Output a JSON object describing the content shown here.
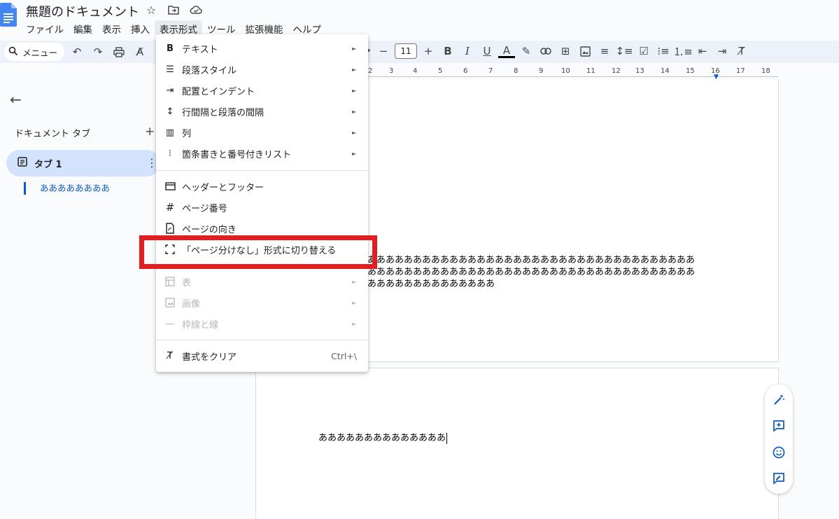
{
  "header": {
    "doc_title": "無題のドキュメント",
    "menu": [
      "ファイル",
      "編集",
      "表示",
      "挿入",
      "表示形式",
      "ツール",
      "拡張機能",
      "ヘルプ"
    ],
    "active_menu": "表示形式"
  },
  "toolbar": {
    "menu_search_label": "メニュー",
    "font_size": "11"
  },
  "sidebar": {
    "tabs_heading": "ドキュメント タブ",
    "tab_label": "タブ 1",
    "outline_item": "ああああああああ"
  },
  "ruler": {
    "ticks": [
      "2",
      "3",
      "4",
      "5",
      "6",
      "7",
      "8",
      "9",
      "10",
      "11",
      "12",
      "13",
      "14",
      "15",
      "16",
      "17",
      "18"
    ]
  },
  "document": {
    "page1_text": "ああああああああああああああああああああああああああああああああああああ\nああああああああああああああああああああああああああああああああああああ\nああああああああああああああ",
    "page2_text": "ああああああああああああああ"
  },
  "format_menu": {
    "items": [
      {
        "label": "テキスト",
        "icon": "bold-icon",
        "submenu": true
      },
      {
        "label": "段落スタイル",
        "icon": "paragraph-style-icon",
        "submenu": true
      },
      {
        "label": "配置とインデント",
        "icon": "indent-icon",
        "submenu": true
      },
      {
        "label": "行間隔と段落の間隔",
        "icon": "line-spacing-icon",
        "submenu": true
      },
      {
        "label": "列",
        "icon": "columns-icon",
        "submenu": true
      },
      {
        "label": "箇条書きと番号付きリスト",
        "icon": "list-icon",
        "submenu": true
      },
      {
        "label": "ヘッダーとフッター",
        "icon": "header-footer-icon",
        "submenu": false
      },
      {
        "label": "ページ番号",
        "icon": "hash-icon",
        "submenu": false
      },
      {
        "label": "ページの向き",
        "icon": "page-orientation-icon",
        "submenu": false
      },
      {
        "label": "「ページ分けなし」形式に切り替える",
        "icon": "pageless-icon",
        "submenu": false
      },
      {
        "label": "表",
        "icon": "table-icon",
        "submenu": true,
        "disabled": true
      },
      {
        "label": "画像",
        "icon": "image-icon",
        "submenu": true,
        "disabled": true
      },
      {
        "label": "枠線と線",
        "icon": "border-line-icon",
        "submenu": true,
        "disabled": true
      },
      {
        "label": "書式をクリア",
        "icon": "clear-format-icon",
        "submenu": false,
        "shortcut": "Ctrl+\\"
      }
    ]
  },
  "colors": {
    "highlight": "#e41e1e",
    "accent": "#0b57d0",
    "selected_tab": "#d3e3fd"
  }
}
